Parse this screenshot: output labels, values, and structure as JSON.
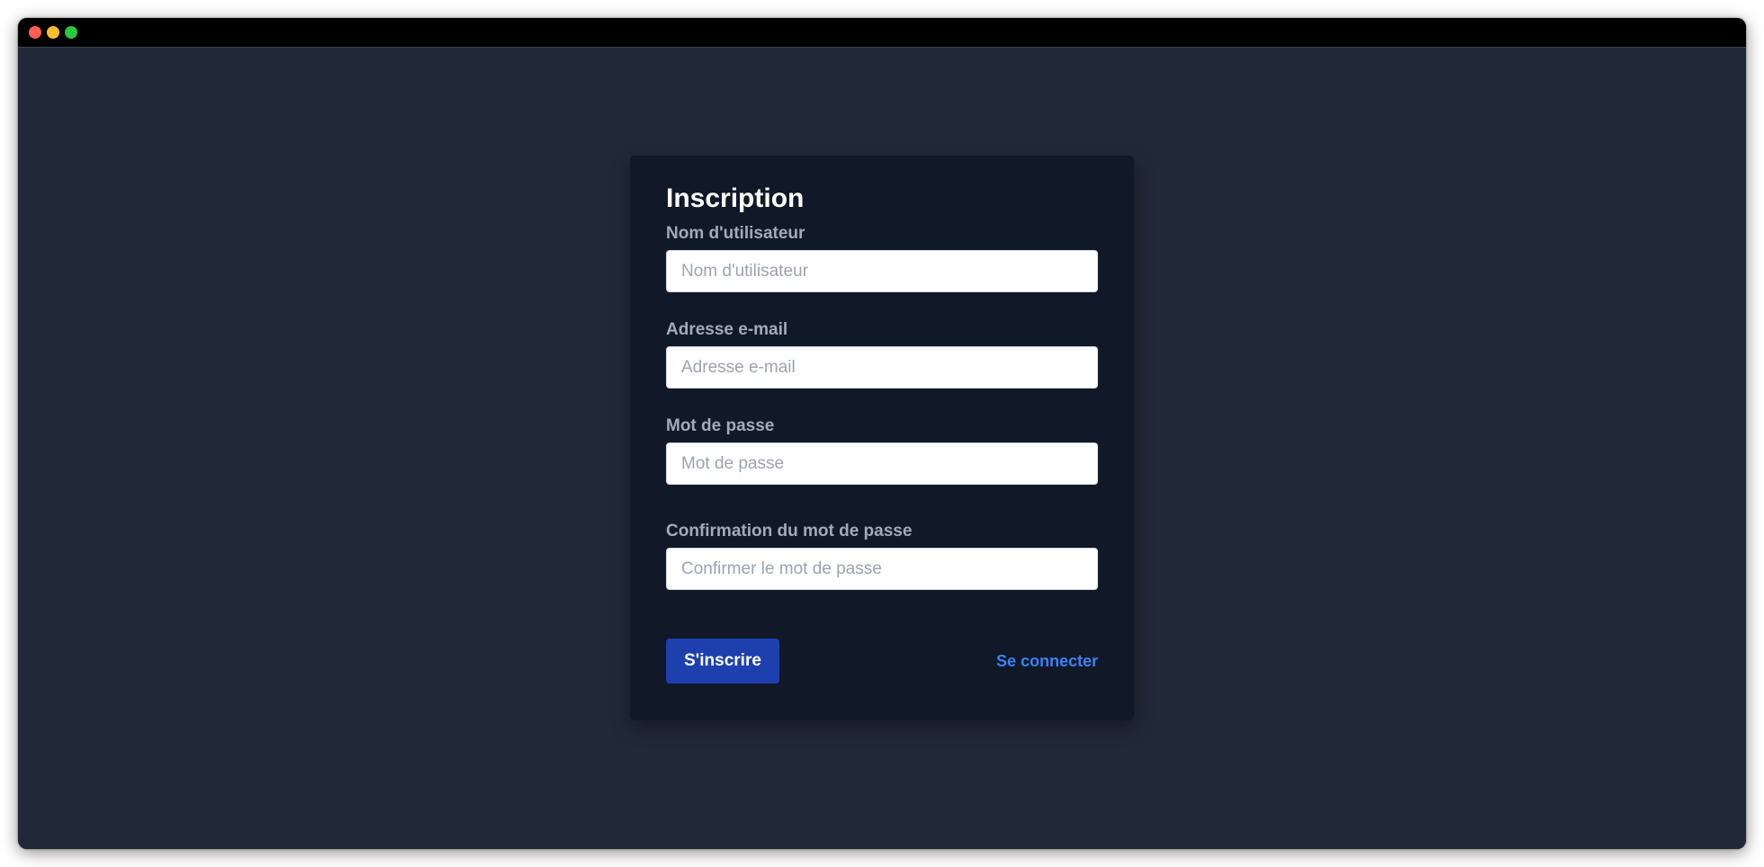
{
  "window": {
    "controls": [
      "close",
      "minimize",
      "maximize"
    ]
  },
  "form": {
    "title": "Inscription",
    "username": {
      "label": "Nom d'utilisateur",
      "placeholder": "Nom d'utilisateur",
      "value": ""
    },
    "email": {
      "label": "Adresse e-mail",
      "placeholder": "Adresse e-mail",
      "value": ""
    },
    "password": {
      "label": "Mot de passe",
      "placeholder": "Mot de passe",
      "value": ""
    },
    "confirm_password": {
      "label": "Confirmation du mot de passe",
      "placeholder": "Confirmer le mot de passe",
      "value": ""
    },
    "submit_label": "S'inscrire",
    "login_link_label": "Se connecter"
  },
  "colors": {
    "page_background": "#212837",
    "card_background": "#111827",
    "label_text": "#a2abbb",
    "primary_button": "#1e40af",
    "link": "#3b82f6"
  }
}
